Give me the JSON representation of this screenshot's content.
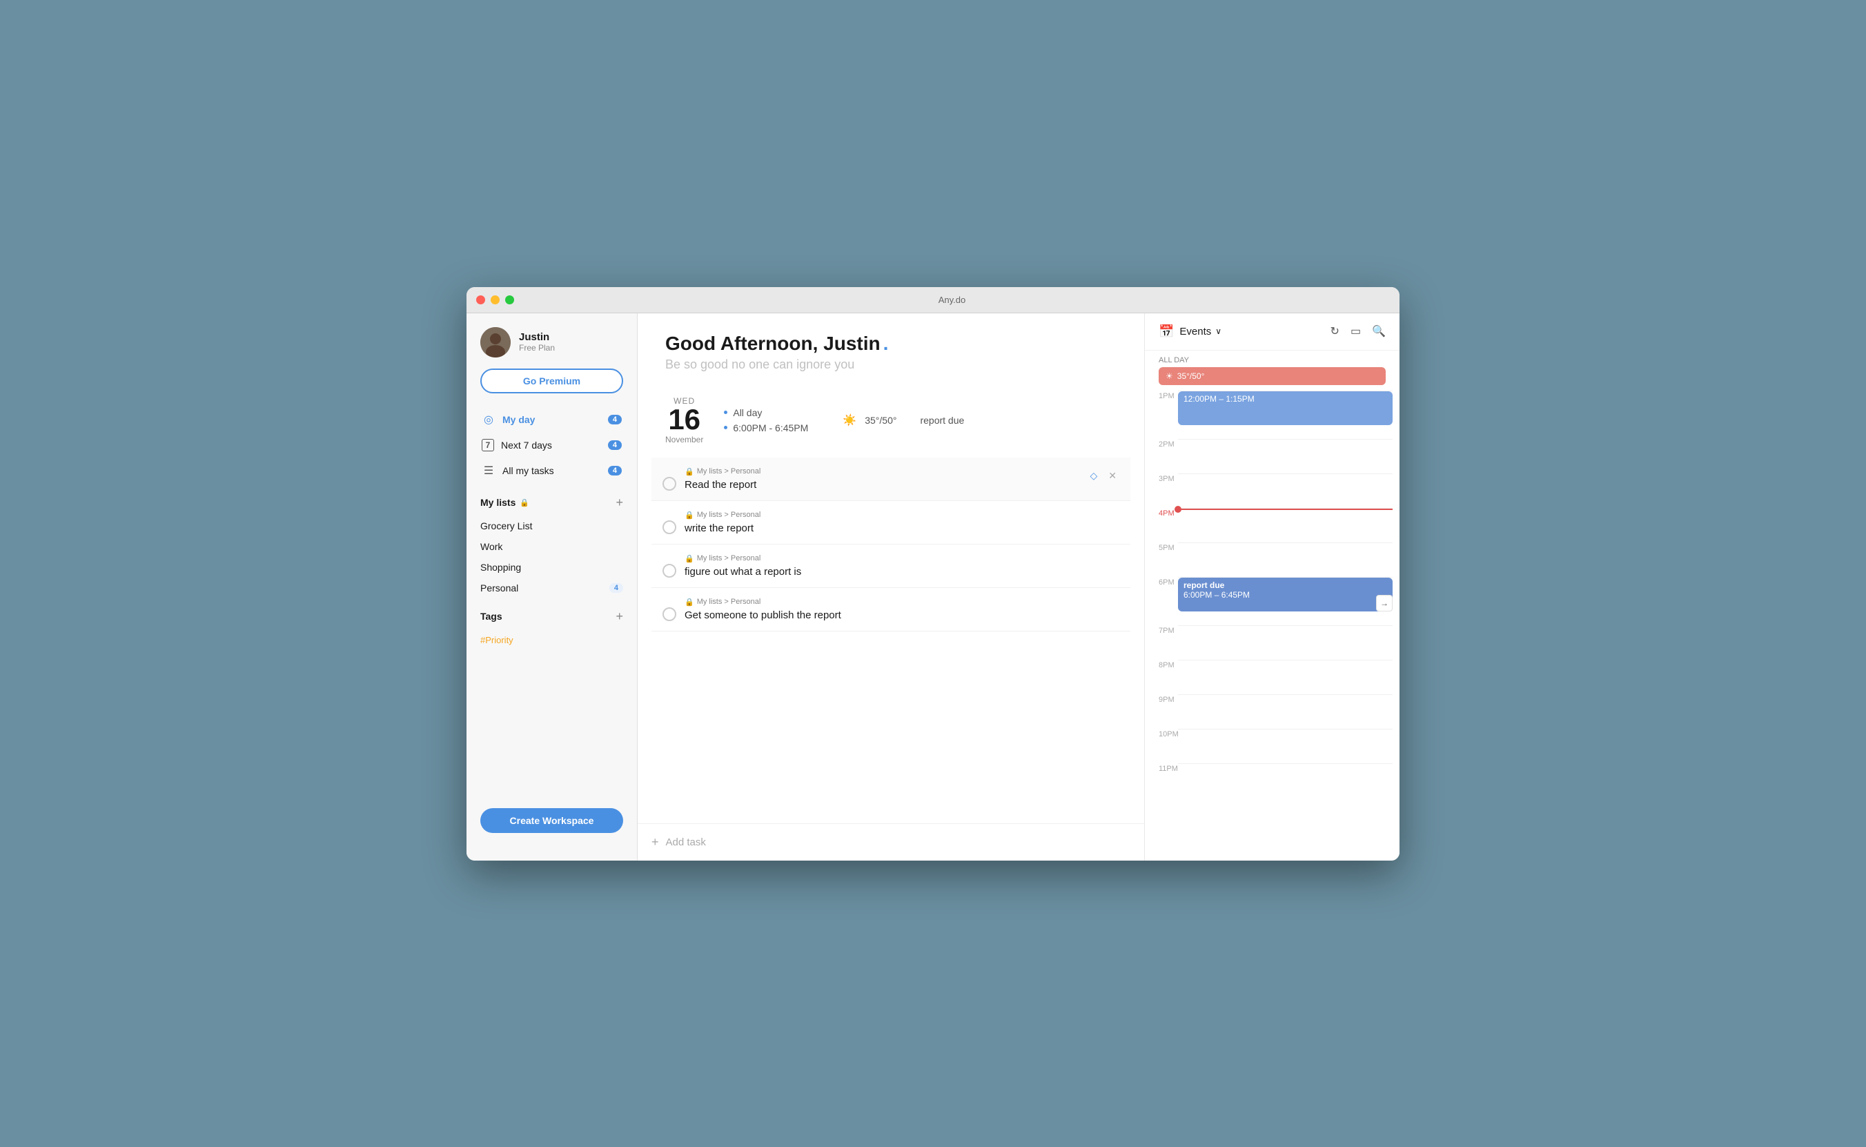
{
  "window": {
    "title": "Any.do"
  },
  "sidebar": {
    "user": {
      "name": "Justin",
      "plan": "Free Plan",
      "go_premium_label": "Go Premium"
    },
    "nav": [
      {
        "id": "my-day",
        "label": "My day",
        "badge": "4",
        "icon": "◎"
      },
      {
        "id": "next-7-days",
        "label": "Next 7 days",
        "badge": "4",
        "icon": "7"
      },
      {
        "id": "all-my-tasks",
        "label": "All my tasks",
        "badge": "4",
        "icon": "☰"
      }
    ],
    "my_lists_label": "My lists",
    "lists": [
      {
        "id": "grocery",
        "label": "Grocery List"
      },
      {
        "id": "work",
        "label": "Work"
      },
      {
        "id": "shopping",
        "label": "Shopping"
      },
      {
        "id": "personal",
        "label": "Personal",
        "badge": "4"
      }
    ],
    "tags_label": "Tags",
    "tags": [
      {
        "id": "priority",
        "label": "#Priority"
      }
    ],
    "create_workspace_label": "Create Workspace"
  },
  "main": {
    "greeting": "Good Afternoon, Justin",
    "greeting_dot": ".",
    "motivational": "Be so good no one can ignore you",
    "date": {
      "day_name": "WED",
      "day_number": "16",
      "month": "November"
    },
    "date_info": [
      {
        "label": "All day"
      },
      {
        "label": "6:00PM - 6:45PM"
      }
    ],
    "weather": {
      "temp": "35°/50°",
      "icon": "☀️"
    },
    "report_due": "report due",
    "tasks": [
      {
        "id": "task-1",
        "breadcrumb": "My lists > Personal",
        "title": "Read the report",
        "pinned": true
      },
      {
        "id": "task-2",
        "breadcrumb": "My lists > Personal",
        "title": "write the report",
        "pinned": false
      },
      {
        "id": "task-3",
        "breadcrumb": "My lists > Personal",
        "title": "figure out what a report is",
        "pinned": false
      },
      {
        "id": "task-4",
        "breadcrumb": "My lists > Personal",
        "title": "Get someone to publish the report",
        "pinned": false
      }
    ],
    "add_task_label": "Add task"
  },
  "calendar": {
    "events_label": "Events",
    "chevron_down": "∨",
    "all_day_label": "ALL DAY",
    "all_day_event": "☀ 35°/50°",
    "time_slots": [
      {
        "label": "1PM"
      },
      {
        "label": "2PM"
      },
      {
        "label": "3PM"
      },
      {
        "label": "4PM"
      },
      {
        "label": "5PM"
      },
      {
        "label": "6PM"
      },
      {
        "label": "7PM"
      },
      {
        "label": "8PM"
      },
      {
        "label": "9PM"
      },
      {
        "label": "10PM"
      },
      {
        "label": "11PM"
      }
    ],
    "events": [
      {
        "id": "event-1",
        "title": "12:00PM – 1:15PM",
        "slot": "1PM",
        "color": "blue"
      },
      {
        "id": "event-2",
        "title": "report due",
        "subtitle": "6:00PM – 6:45PM",
        "slot": "6PM",
        "color": "blue-darker"
      }
    ]
  }
}
